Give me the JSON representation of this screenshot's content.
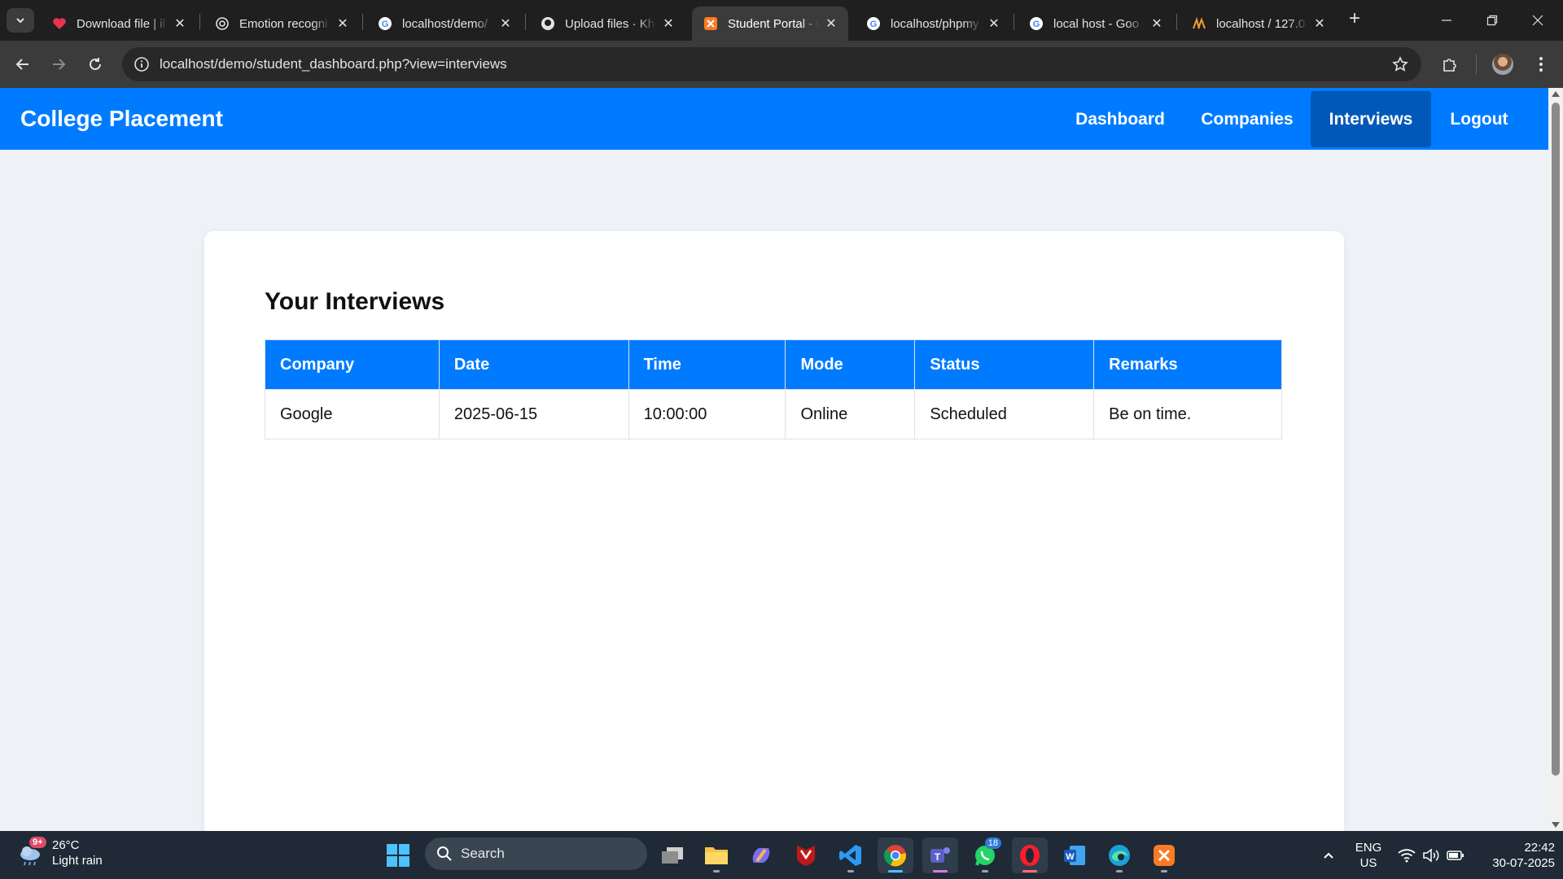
{
  "browser": {
    "tabs": [
      {
        "title": "Download file | il",
        "icon": "heart-icon"
      },
      {
        "title": "Emotion recogni",
        "icon": "openai-icon"
      },
      {
        "title": "localhost/demo/",
        "icon": "google-icon"
      },
      {
        "title": "Upload files · Khu",
        "icon": "github-icon"
      },
      {
        "title": "Student Portal - C",
        "icon": "xampp-icon",
        "active": true
      },
      {
        "title": "localhost/phpmy",
        "icon": "google-icon"
      },
      {
        "title": "local host - Goo",
        "icon": "google-icon"
      },
      {
        "title": "localhost / 127.0",
        "icon": "phpmyadmin-icon"
      }
    ],
    "address": "localhost/demo/student_dashboard.php?view=interviews"
  },
  "site": {
    "brand": "College Placement",
    "nav": [
      {
        "label": "Dashboard"
      },
      {
        "label": "Companies"
      },
      {
        "label": "Interviews",
        "active": true
      },
      {
        "label": "Logout"
      }
    ],
    "accent": "#007bff"
  },
  "interviews": {
    "heading": "Your Interviews",
    "columns": [
      "Company",
      "Date",
      "Time",
      "Mode",
      "Status",
      "Remarks"
    ],
    "rows": [
      [
        "Google",
        "2025-06-15",
        "10:00:00",
        "Online",
        "Scheduled",
        "Be on time."
      ]
    ]
  },
  "taskbar": {
    "weather": {
      "badge": "9+",
      "temp": "26°C",
      "desc": "Light rain"
    },
    "search_label": "Search",
    "whatsapp_badge": "18",
    "lang": {
      "line1": "ENG",
      "line2": "US"
    },
    "clock": {
      "time": "22:42",
      "date": "30-07-2025"
    }
  }
}
